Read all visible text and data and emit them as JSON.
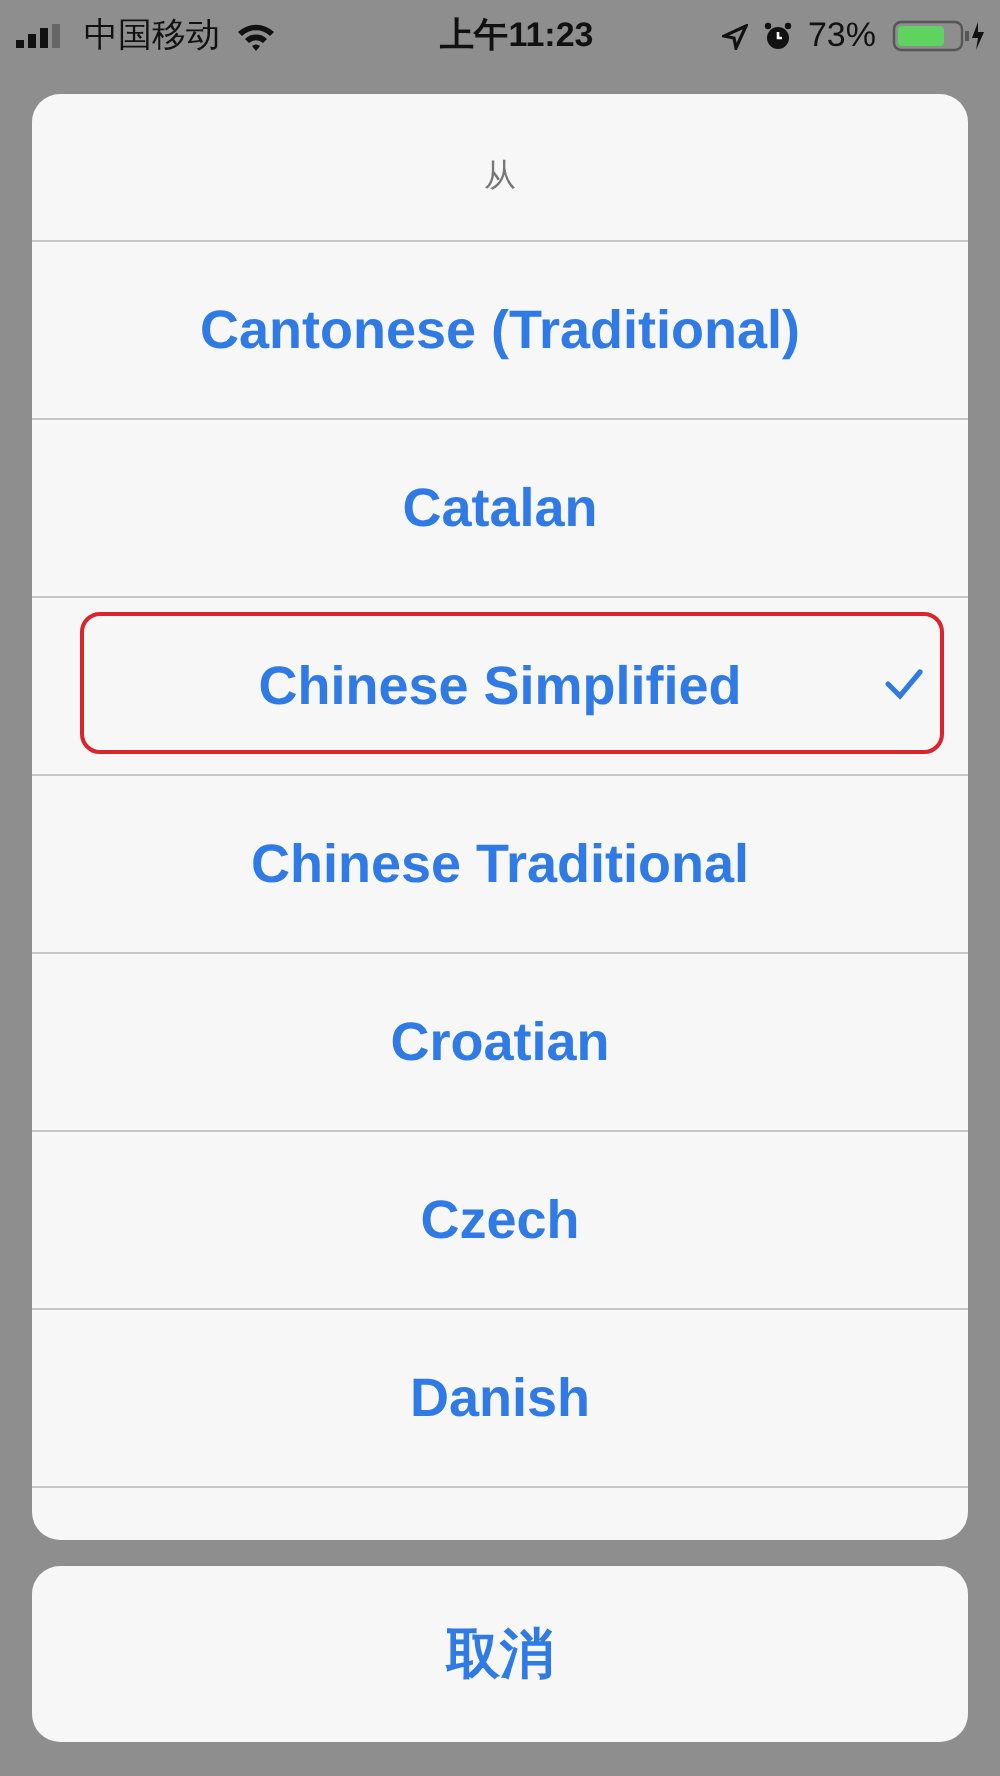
{
  "status_bar": {
    "carrier": "中国移动",
    "time": "上午11:23",
    "battery": "73%"
  },
  "sheet": {
    "title": "从",
    "options": [
      {
        "label": "Cantonese (Traditional)",
        "selected": false,
        "highlighted": false
      },
      {
        "label": "Catalan",
        "selected": false,
        "highlighted": false
      },
      {
        "label": "Chinese Simplified",
        "selected": true,
        "highlighted": true
      },
      {
        "label": "Chinese Traditional",
        "selected": false,
        "highlighted": false
      },
      {
        "label": "Croatian",
        "selected": false,
        "highlighted": false
      },
      {
        "label": "Czech",
        "selected": false,
        "highlighted": false
      },
      {
        "label": "Danish",
        "selected": false,
        "highlighted": false
      }
    ]
  },
  "cancel_button": "取消"
}
